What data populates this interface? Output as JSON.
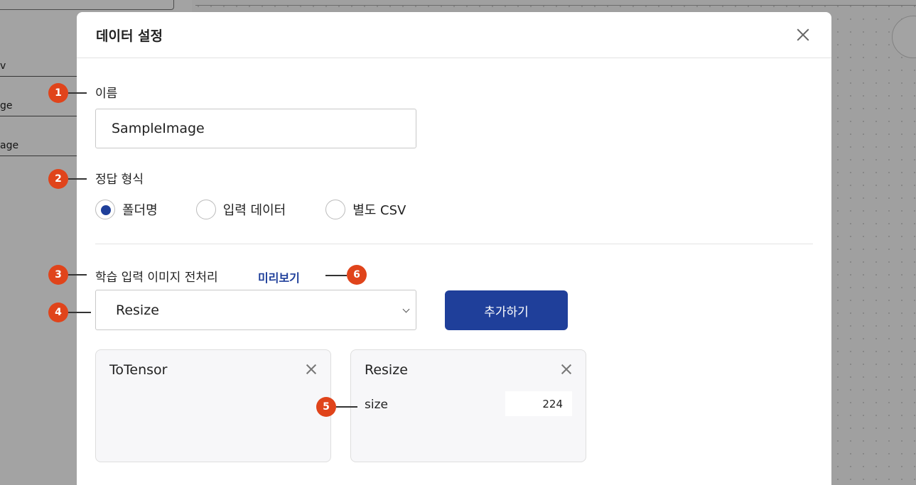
{
  "modal": {
    "title": "데이터 설정",
    "name_label": "이름",
    "name_value": "SampleImage",
    "answer_format_label": "정답 형식",
    "answer_options": [
      {
        "label": "폴더명",
        "checked": true
      },
      {
        "label": "입력 데이터",
        "checked": false
      },
      {
        "label": "별도 CSV",
        "checked": false
      }
    ],
    "preprocess_label": "학습 입력 이미지 전처리",
    "preview_link": "미리보기",
    "select_value": "Resize",
    "add_button": "추가하기",
    "cards": [
      {
        "title": "ToTensor"
      },
      {
        "title": "Resize",
        "param_label": "size",
        "param_value": "224"
      }
    ]
  },
  "background": {
    "left_rows": [
      "v",
      "ge",
      "age"
    ]
  },
  "annotations": [
    "1",
    "2",
    "3",
    "4",
    "5",
    "6"
  ],
  "colors": {
    "primary": "#1f3f9a",
    "badge": "#e0441b"
  }
}
